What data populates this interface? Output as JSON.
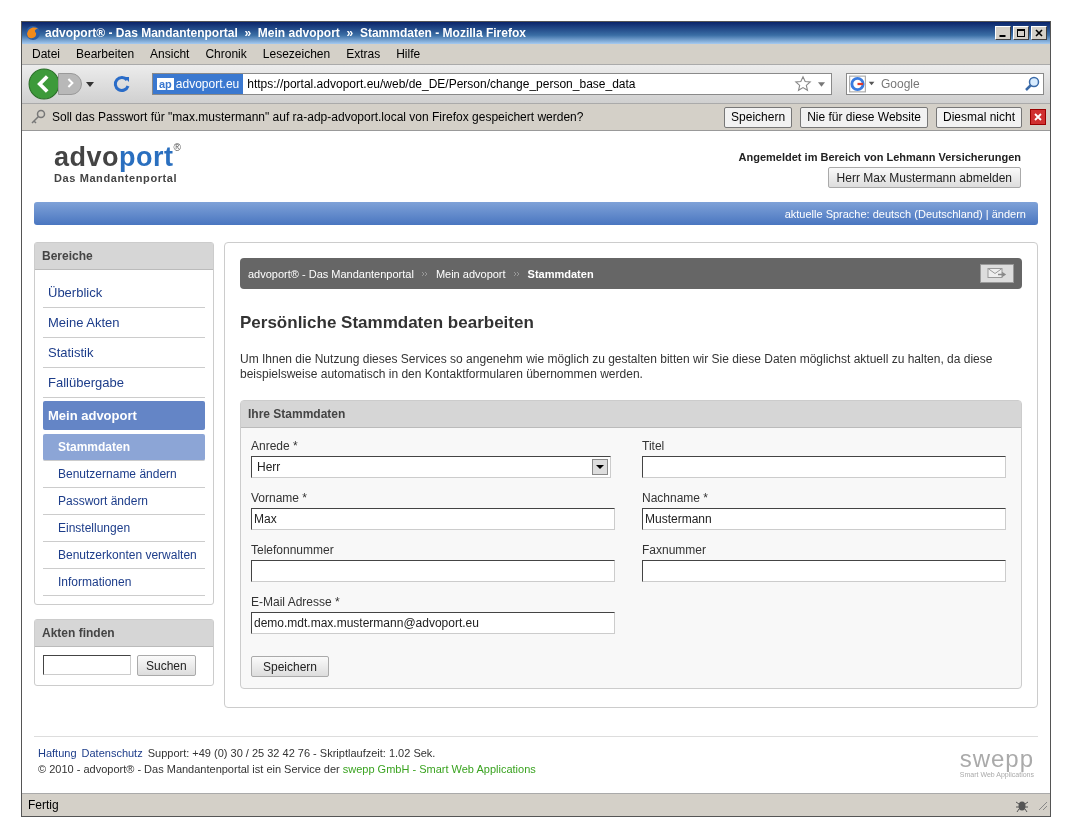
{
  "window": {
    "title": "advoport® - Das Mandantenportal  »  Mein advoport  »  Stammdaten - Mozilla Firefox"
  },
  "menu": [
    "Datei",
    "Bearbeiten",
    "Ansicht",
    "Chronik",
    "Lesezeichen",
    "Extras",
    "Hilfe"
  ],
  "navbar": {
    "site_badge": "ap",
    "site_name": "advoport.eu",
    "url": "https://portal.advoport.eu/web/de_DE/Person/change_person_base_data",
    "search_placeholder": "Google"
  },
  "notification": {
    "message": "Soll das Passwort für \"max.mustermann\" auf ra-adp-advoport.local von Firefox gespeichert werden?",
    "buttons": [
      "Speichern",
      "Nie für diese Website",
      "Diesmal nicht"
    ]
  },
  "header": {
    "logo": {
      "dark": "advo",
      "accent": "port",
      "mark": "®",
      "tagline": "Das Mandantenportal"
    },
    "login_info": "Angemeldet im Bereich von Lehmann Versicherungen",
    "logout_button": "Herr Max Mustermann abmelden",
    "language": "aktuelle Sprache: deutsch (Deutschland) | ändern"
  },
  "sidebar": {
    "title": "Bereiche",
    "items": [
      {
        "label": "Überblick",
        "selected": false
      },
      {
        "label": "Meine Akten",
        "selected": false
      },
      {
        "label": "Statistik",
        "selected": false
      },
      {
        "label": "Fallübergabe",
        "selected": false
      },
      {
        "label": "Mein advoport",
        "selected": true,
        "children": [
          {
            "label": "Stammdaten",
            "selected": true
          },
          {
            "label": "Benutzername ändern",
            "selected": false
          },
          {
            "label": "Passwort ändern",
            "selected": false
          },
          {
            "label": "Einstellungen",
            "selected": false
          },
          {
            "label": "Benutzerkonten verwalten",
            "selected": false
          },
          {
            "label": "Informationen",
            "selected": false
          }
        ]
      }
    ]
  },
  "search_box": {
    "title": "Akten finden",
    "button": "Suchen"
  },
  "breadcrumb": [
    "advoport® - Das Mandantenportal",
    "Mein advoport",
    "Stammdaten"
  ],
  "page": {
    "title": "Persönliche Stammdaten bearbeiten",
    "intro": "Um Ihnen die Nutzung dieses Services so angenehm wie möglich zu gestalten bitten wir Sie diese Daten möglichst aktuell zu halten, da diese beispielsweise automatisch in den Kontaktformularen übernommen werden."
  },
  "form": {
    "title": "Ihre Stammdaten",
    "fields": [
      {
        "kind": "select",
        "label": "Anrede *",
        "value": "Herr"
      },
      {
        "kind": "text",
        "label": "Titel"
      },
      {
        "kind": "text",
        "label": "Vorname *",
        "value": "Max"
      },
      {
        "kind": "text",
        "label": "Nachname *",
        "value": "Mustermann"
      },
      {
        "kind": "text",
        "label": "Telefonnummer"
      },
      {
        "kind": "text",
        "label": "Faxnummer"
      },
      {
        "kind": "text",
        "label": "E-Mail Adresse *",
        "value": "demo.mdt.max.mustermann@advoport.eu"
      }
    ],
    "submit": "Speichern"
  },
  "footer": {
    "links": [
      "Haftung",
      "Datenschutz"
    ],
    "support": "Support: +49 (0) 30 / 25 32 42 76 - Skriptlaufzeit: 1.02 Sek.",
    "copyright": "© 2010 - advoport® - Das Mandantenportal ist ein Service der",
    "company_link": "swepp GmbH - Smart Web Applications",
    "brand": "swepp",
    "brand_tagline": "Smart Web Applications"
  },
  "status_bar": {
    "text": "Fertig"
  }
}
